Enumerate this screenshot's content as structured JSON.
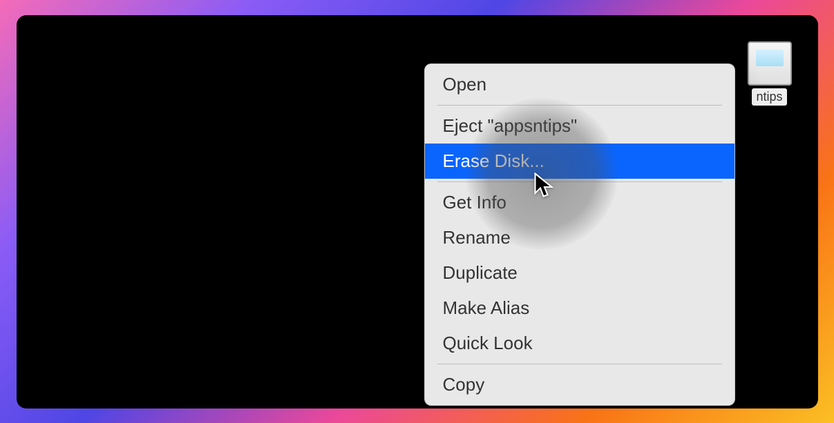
{
  "disk": {
    "name": "ntips",
    "full_name": "appsntips"
  },
  "context_menu": {
    "groups": [
      {
        "items": [
          {
            "label": "Open"
          }
        ]
      },
      {
        "items": [
          {
            "label": "Eject \"appsntips\""
          },
          {
            "label": "Erase Disk...",
            "highlighted": true
          }
        ]
      },
      {
        "items": [
          {
            "label": "Get Info"
          },
          {
            "label": "Rename"
          },
          {
            "label": "Duplicate"
          },
          {
            "label": "Make Alias"
          },
          {
            "label": "Quick Look"
          }
        ]
      },
      {
        "items": [
          {
            "label": "Copy"
          }
        ]
      }
    ]
  },
  "colors": {
    "highlight": "#0a65ff",
    "menu_bg": "#e8e8e8",
    "desktop_bg": "#000000"
  }
}
